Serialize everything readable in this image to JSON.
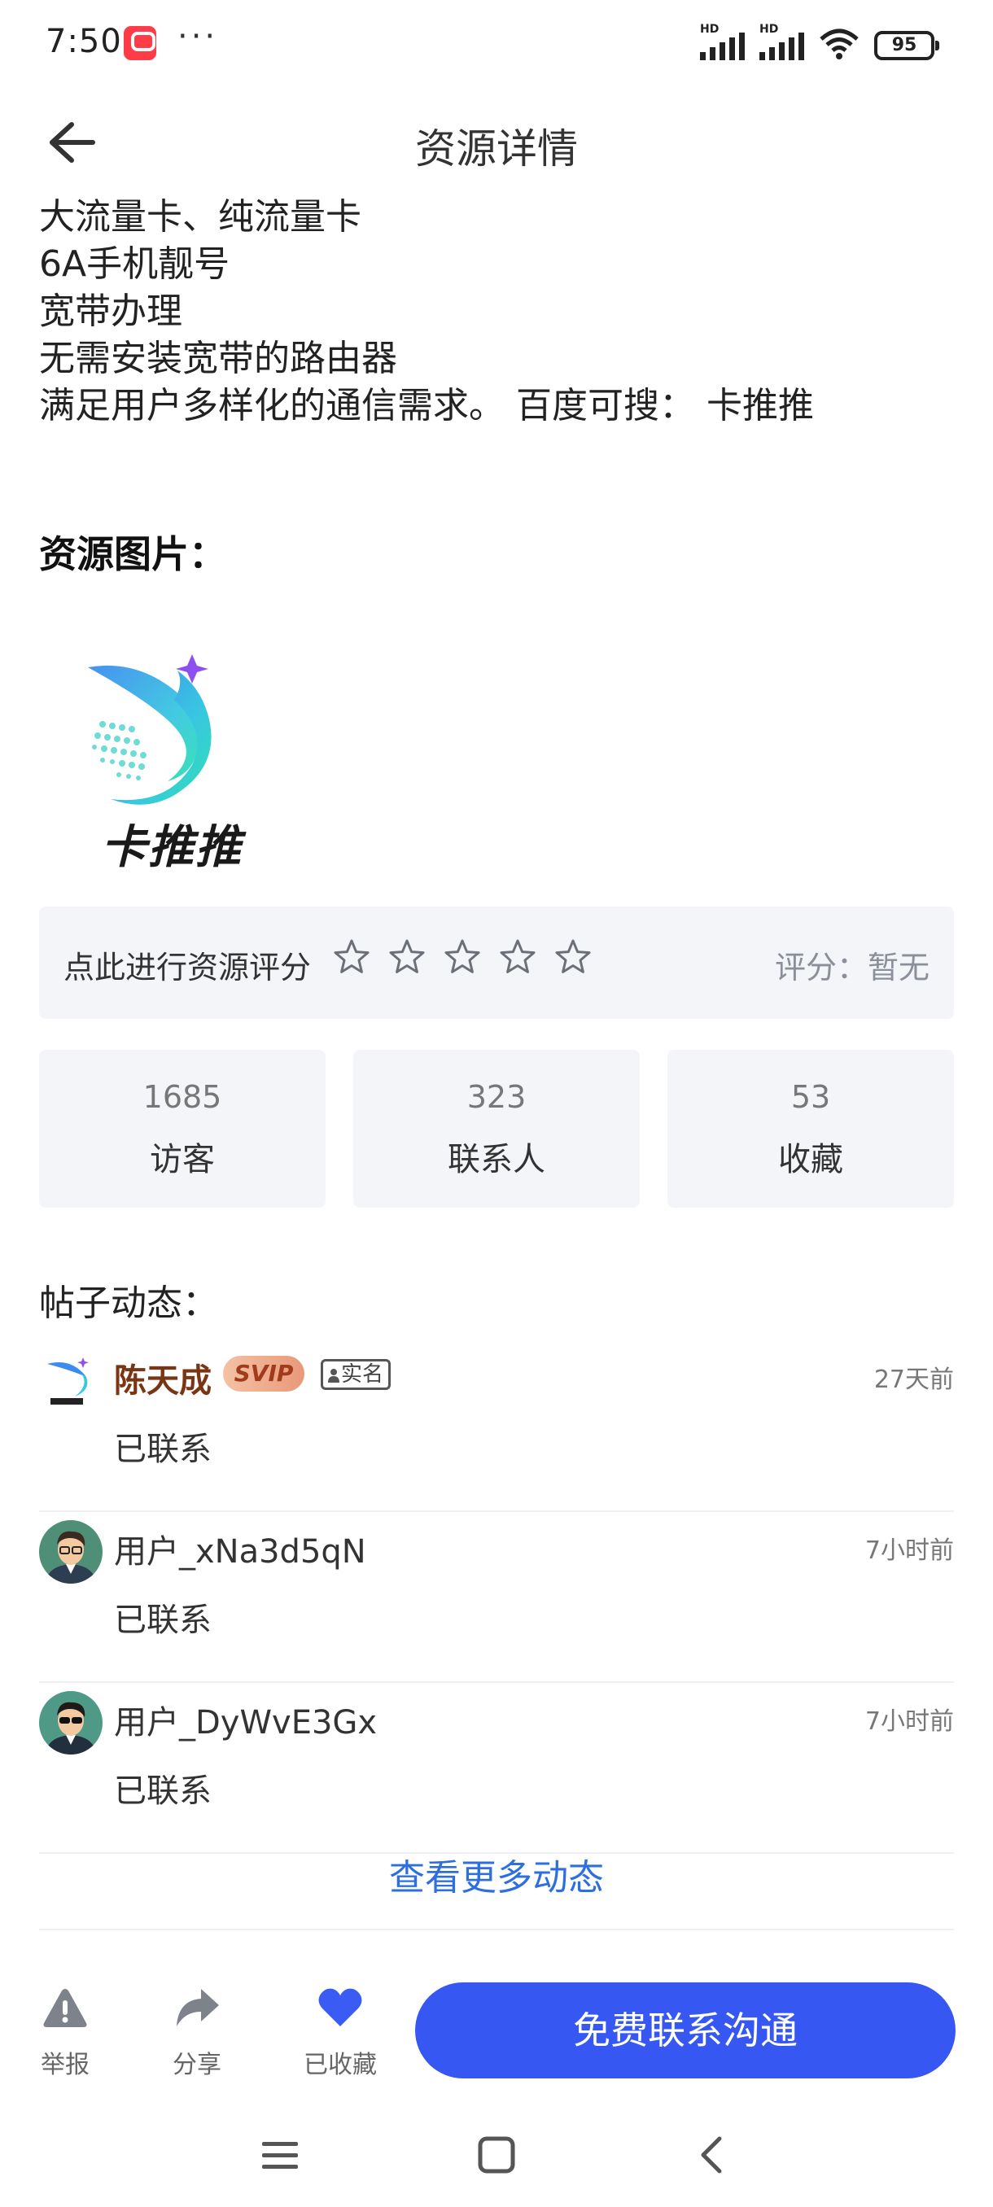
{
  "status_bar": {
    "time": "7:50",
    "dots": "···",
    "battery": "95",
    "signal_label": "HD",
    "wifi_label": "6"
  },
  "nav": {
    "title": "资源详情"
  },
  "description": {
    "lines": [
      "大流量卡、纯流量卡",
      "6A手机靓号",
      "宽带办理",
      "无需安装宽带的路由器",
      "满足用户多样化的通信需求。 百度可搜： 卡推推"
    ]
  },
  "images_section": {
    "title": "资源图片：",
    "logo_text": "卡推推"
  },
  "rating": {
    "prompt": "点此进行资源评分",
    "stars_total": 5,
    "stars_filled": 0,
    "score_label": "评分：暂无"
  },
  "stats": [
    {
      "value": "1685",
      "label": "访客"
    },
    {
      "value": "323",
      "label": "联系人"
    },
    {
      "value": "53",
      "label": "收藏"
    }
  ],
  "feed": {
    "title": "帖子动态：",
    "items": [
      {
        "name": "陈天成",
        "badge_svip": "SVIP",
        "badge_realname": "实名",
        "time": "27天前",
        "action": "已联系"
      },
      {
        "name": "用户_xNa3d5qN",
        "time": "7小时前",
        "action": "已联系"
      },
      {
        "name": "用户_DyWvE3Gx",
        "time": "7小时前",
        "action": "已联系"
      }
    ],
    "more": "查看更多动态"
  },
  "bottom_bar": {
    "report": "举报",
    "share": "分享",
    "favorite": "已收藏",
    "contact": "免费联系沟通"
  },
  "colors": {
    "accent": "#3757f2",
    "link": "#2d6fe0",
    "favorite": "#3a5cf5",
    "card_bg": "#f3f5f9",
    "vip_name": "#7a3512"
  }
}
